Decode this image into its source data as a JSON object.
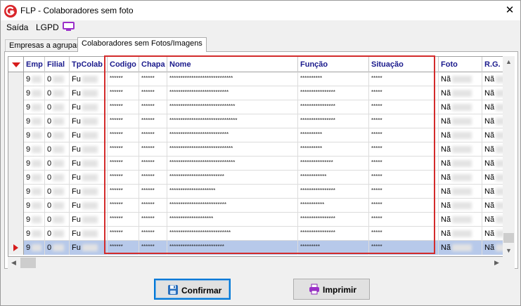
{
  "window": {
    "title": "FLP - Colaboradores sem foto"
  },
  "menu": {
    "items": [
      "Saída",
      "LGPD"
    ]
  },
  "tabs": [
    {
      "label": "Empresas a agrupar",
      "active": false
    },
    {
      "label": "Colaboradores sem Fotos/Imagens",
      "active": true
    }
  ],
  "grid": {
    "columns": [
      "Emp",
      "Filial",
      "TpColab",
      "Codigo",
      "Chapa",
      "Nome",
      "Função",
      "Situação",
      "Foto",
      "R.G. F"
    ],
    "rows": [
      {
        "emp": "9",
        "filial": "0",
        "tpcolab": "Fu",
        "codigo": "******",
        "chapa": "******",
        "nome": "*****************************",
        "funcao": "**********",
        "situacao": "*****",
        "foto": "Nã",
        "rg": "Nã"
      },
      {
        "emp": "9",
        "filial": "0",
        "tpcolab": "Fu",
        "codigo": "******",
        "chapa": "******",
        "nome": "***************************",
        "funcao": "****************",
        "situacao": "*****",
        "foto": "Nã",
        "rg": "Nã"
      },
      {
        "emp": "9",
        "filial": "0",
        "tpcolab": "Fu",
        "codigo": "******",
        "chapa": "******",
        "nome": "******************************",
        "funcao": "****************",
        "situacao": "*****",
        "foto": "Nã",
        "rg": "Nã"
      },
      {
        "emp": "9",
        "filial": "0",
        "tpcolab": "Fu",
        "codigo": "******",
        "chapa": "******",
        "nome": "*******************************",
        "funcao": "****************",
        "situacao": "*****",
        "foto": "Nã",
        "rg": "Nã"
      },
      {
        "emp": "9",
        "filial": "0",
        "tpcolab": "Fu",
        "codigo": "******",
        "chapa": "******",
        "nome": "***************************",
        "funcao": "**********",
        "situacao": "*****",
        "foto": "Nã",
        "rg": "Nã"
      },
      {
        "emp": "9",
        "filial": "0",
        "tpcolab": "Fu",
        "codigo": "******",
        "chapa": "******",
        "nome": "*****************************",
        "funcao": "**********",
        "situacao": "*****",
        "foto": "Nã",
        "rg": "Nã"
      },
      {
        "emp": "9",
        "filial": "0",
        "tpcolab": "Fu",
        "codigo": "******",
        "chapa": "******",
        "nome": "******************************",
        "funcao": "***************",
        "situacao": "*****",
        "foto": "Nã",
        "rg": "Nã"
      },
      {
        "emp": "9",
        "filial": "0",
        "tpcolab": "Fu",
        "codigo": "******",
        "chapa": "******",
        "nome": "*************************",
        "funcao": "************",
        "situacao": "*****",
        "foto": "Nã",
        "rg": "Nã"
      },
      {
        "emp": "9",
        "filial": "0",
        "tpcolab": "Fu",
        "codigo": "******",
        "chapa": "******",
        "nome": "*********************",
        "funcao": "****************",
        "situacao": "*****",
        "foto": "Nã",
        "rg": "Nã"
      },
      {
        "emp": "9",
        "filial": "0",
        "tpcolab": "Fu",
        "codigo": "******",
        "chapa": "******",
        "nome": "**************************",
        "funcao": "***********",
        "situacao": "*****",
        "foto": "Nã",
        "rg": "Nã"
      },
      {
        "emp": "9",
        "filial": "0",
        "tpcolab": "Fu",
        "codigo": "******",
        "chapa": "******",
        "nome": "********************",
        "funcao": "****************",
        "situacao": "*****",
        "foto": "Nã",
        "rg": "Nã"
      },
      {
        "emp": "9",
        "filial": "0",
        "tpcolab": "Fu",
        "codigo": "******",
        "chapa": "******",
        "nome": "****************************",
        "funcao": "****************",
        "situacao": "*****",
        "foto": "Nã",
        "rg": "Nã"
      },
      {
        "emp": "9",
        "filial": "0",
        "tpcolab": "Fu",
        "codigo": "******",
        "chapa": "******",
        "nome": "*************************",
        "funcao": "*********",
        "situacao": "*****",
        "foto": "Nã",
        "rg": "Nã",
        "selected": true
      }
    ]
  },
  "buttons": {
    "confirm": "Confirmar",
    "print": "Imprimir"
  },
  "colors": {
    "highlight": "#d32b2b",
    "selection": "#b7c9ea",
    "header_text": "#1a1a8c",
    "focus": "#0078d7"
  },
  "icons": {
    "app": "flp-logo-icon",
    "lgpd": "monitor-icon",
    "close": "close-icon",
    "save": "floppy-disk-icon",
    "print": "printer-icon"
  }
}
